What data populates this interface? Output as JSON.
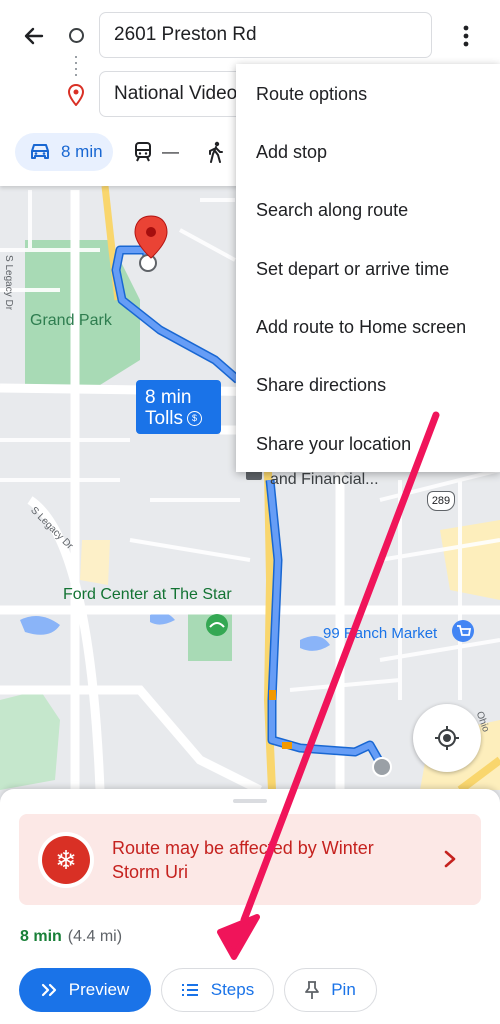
{
  "directions": {
    "origin": "2601 Preston Rd",
    "destination": "National Video"
  },
  "modes": {
    "drive": {
      "time": "8 min",
      "icon": "car-icon"
    },
    "transit": {
      "time": "—",
      "icon": "train-icon"
    },
    "walk": {
      "icon": "walk-icon"
    }
  },
  "menu": {
    "items": [
      "Route options",
      "Add stop",
      "Search along route",
      "Set depart or arrive time",
      "Add route to Home screen",
      "Share directions",
      "Share your location"
    ]
  },
  "map": {
    "labels": {
      "grand_park": "Grand Park",
      "ford_center": "Ford Center at The Star",
      "ranch_market": "99 Ranch Market",
      "financial": "and Financial...",
      "legacy_dr_1": "S Legacy Dr",
      "legacy_dr_2": "S Legacy Dr",
      "ohio": "Ohio",
      "shield_289": "289"
    },
    "route_badge": {
      "time": "8 min",
      "tolls": "Tolls"
    }
  },
  "sheet": {
    "alert": "Route may be affected by Winter Storm Uri",
    "summary_time": "8 min",
    "summary_distance": "(4.4 mi)",
    "buttons": {
      "preview": "Preview",
      "steps": "Steps",
      "pin": "Pin"
    }
  },
  "colors": {
    "accent": "#1a73e8",
    "alert_bg": "#fce8e6",
    "alert_text": "#c5221f",
    "annotation_arrow": "#f0145a"
  }
}
